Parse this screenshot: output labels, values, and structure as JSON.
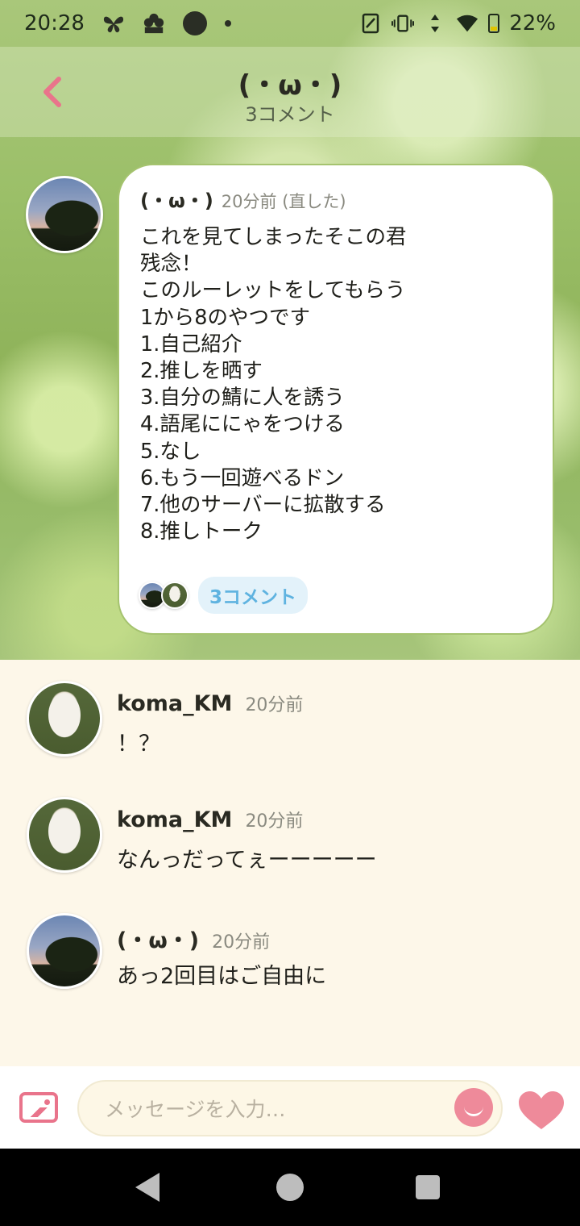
{
  "status_bar": {
    "time": "20:28",
    "battery": "22%",
    "icons": [
      "butterfly-icon",
      "sakura-badge-icon",
      "circle-icon",
      "dot-icon",
      "nfc-icon",
      "vibrate-icon",
      "data-arrows-icon",
      "wifi-icon",
      "battery-icon"
    ]
  },
  "header": {
    "title": "(・ω・)",
    "subtitle": "3コメント",
    "back_icon": "chevron-left-icon"
  },
  "post": {
    "author": "(・ω・)",
    "time": "20分前 (直した)",
    "lines": [
      "これを見てしまったそこの君",
      "残念！",
      "このルーレットをしてもらう",
      "1から8のやつです",
      "1.自己紹介",
      "2.推しを晒す",
      "3.自分の鯖に人を誘う",
      "4.語尾ににゃをつける",
      "5.なし",
      "6.もう一回遊べるドン",
      "7.他のサーバーに拡散する",
      "8.推しトーク"
    ],
    "comment_count_label": "3コメント"
  },
  "comments": [
    {
      "author": "koma_KM",
      "time": "20分前",
      "text": "！？"
    },
    {
      "author": "koma_KM",
      "time": "20分前",
      "text": "なんっだってぇーーーーー"
    },
    {
      "author": "(・ω・)",
      "time": "20分前",
      "text": "あっ2回目はご自由に"
    }
  ],
  "input": {
    "placeholder": "メッセージを入力…"
  },
  "colors": {
    "accent_pink": "#e9748b",
    "pill_blue": "#5fb3e0",
    "comments_bg": "#fdf7e9"
  }
}
